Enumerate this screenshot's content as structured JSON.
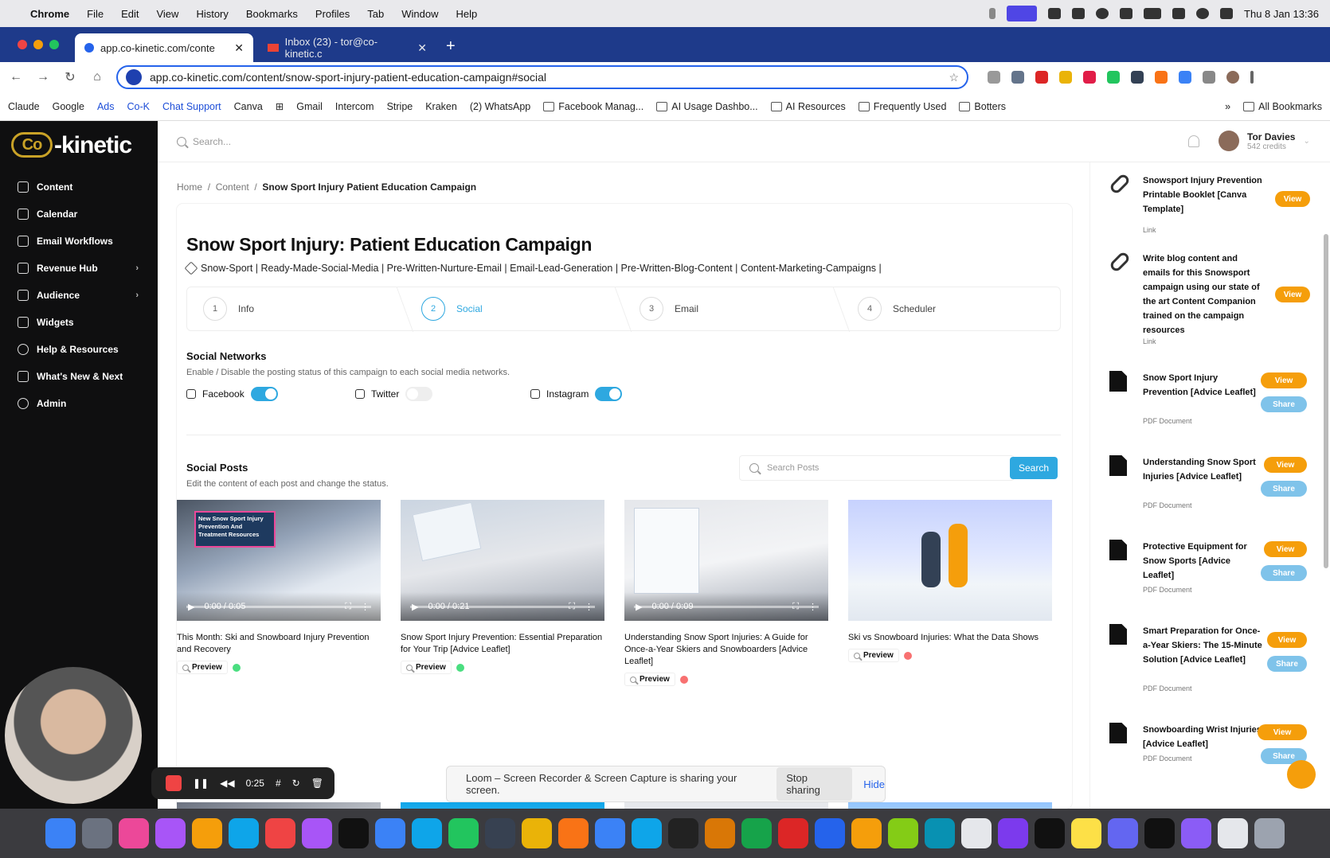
{
  "menubar": {
    "app": "Chrome",
    "items": [
      "File",
      "Edit",
      "View",
      "History",
      "Bookmarks",
      "Profiles",
      "Tab",
      "Window",
      "Help"
    ],
    "clock": "Thu 8 Jan  13:36"
  },
  "tabs": [
    {
      "title": "app.co-kinetic.com/conte",
      "close": "✕"
    },
    {
      "title": "Inbox (23) - tor@co-kinetic.c",
      "close": "✕"
    }
  ],
  "newtab": "+",
  "url": "app.co-kinetic.com/content/snow-sport-injury-patient-education-campaign#social",
  "bookmarks": [
    "Claude",
    "Google",
    "Ads",
    "Co-K",
    "Chat Support",
    "Canva",
    "Gmail",
    "Intercom",
    "Stripe",
    "Kraken",
    "(2) WhatsApp",
    "Facebook Manag...",
    "AI Usage Dashbo...",
    "AI Resources",
    "Frequently Used",
    "Botters"
  ],
  "bookmarks_more": "»",
  "all_bookmarks": "All Bookmarks",
  "logo": {
    "co": "Co",
    "text": "-kinetic"
  },
  "sidebar": [
    {
      "label": "Content",
      "chev": ""
    },
    {
      "label": "Calendar",
      "chev": ""
    },
    {
      "label": "Email Workflows",
      "chev": ""
    },
    {
      "label": "Revenue Hub",
      "chev": "›"
    },
    {
      "label": "Audience",
      "chev": "›"
    },
    {
      "label": "Widgets",
      "chev": ""
    },
    {
      "label": "Help & Resources",
      "chev": ""
    },
    {
      "label": "What's New & Next",
      "chev": ""
    },
    {
      "label": "Admin",
      "chev": ""
    }
  ],
  "topbar": {
    "search_placeholder": "Search...",
    "user_name": "Tor Davies",
    "user_credits": "542 credits"
  },
  "breadcrumb": {
    "home": "Home",
    "sep": "/",
    "content": "Content",
    "current": "Snow Sport Injury Patient Education Campaign"
  },
  "page": {
    "title": "Snow Sport Injury: Patient Education Campaign",
    "tags": "Snow-Sport | Ready-Made-Social-Media | Pre-Written-Nurture-Email | Email-Lead-Generation | Pre-Written-Blog-Content | Content-Marketing-Campaigns |"
  },
  "steps": [
    {
      "num": "1",
      "label": "Info"
    },
    {
      "num": "2",
      "label": "Social"
    },
    {
      "num": "3",
      "label": "Email"
    },
    {
      "num": "4",
      "label": "Scheduler"
    }
  ],
  "social_networks": {
    "title": "Social Networks",
    "subtitle": "Enable / Disable the posting status of this campaign to each social media networks.",
    "networks": [
      {
        "name": "Facebook",
        "enabled": true
      },
      {
        "name": "Twitter",
        "enabled": false
      },
      {
        "name": "Instagram",
        "enabled": true
      }
    ]
  },
  "social_posts": {
    "title": "Social Posts",
    "subtitle": "Edit the content of each post and change the status.",
    "search_placeholder": "Search Posts",
    "search_button": "Search",
    "preview_label": "Preview",
    "posts": [
      {
        "title": "This Month: Ski and Snowboard Injury Prevention and Recovery",
        "time": "0:00 / 0:05",
        "status_color": "#4ade80",
        "overlay": "New Snow Sport Injury Prevention And Treatment Resources"
      },
      {
        "title": "Snow Sport Injury Prevention: Essential Preparation for Your Trip [Advice Leaflet]",
        "time": "0:00 / 0:21",
        "status_color": "#4ade80",
        "overlay": ""
      },
      {
        "title": "Understanding Snow Sport Injuries: A Guide for Once-a-Year Skiers and Snowboarders [Advice Leaflet]",
        "time": "0:00 / 0:09",
        "status_color": "#f87171",
        "overlay": ""
      },
      {
        "title": "Ski vs Snowboard Injuries: What the Data Shows",
        "time": "",
        "status_color": "#f87171",
        "overlay": ""
      }
    ]
  },
  "resources": [
    {
      "title": "Snowsport Injury Prevention Printable Booklet [Canva Template]",
      "type": "Link",
      "icon": "link",
      "view": "View",
      "share": ""
    },
    {
      "title": "Write blog content and emails for this Snowsport campaign using our state of the art Content Companion trained on the campaign resources",
      "type": "Link",
      "icon": "link",
      "view": "View",
      "share": ""
    },
    {
      "title": "Snow Sport Injury Prevention [Advice Leaflet]",
      "type": "PDF Document",
      "icon": "doc",
      "view": "View",
      "share": "Share"
    },
    {
      "title": "Understanding Snow Sport Injuries [Advice Leaflet]",
      "type": "PDF Document",
      "icon": "doc",
      "view": "View",
      "share": "Share"
    },
    {
      "title": "Protective Equipment for Snow Sports [Advice Leaflet]",
      "type": "PDF Document",
      "icon": "doc",
      "view": "View",
      "share": "Share"
    },
    {
      "title": "Smart Preparation for Once-a-Year Skiers: The 15-Minute Solution [Advice Leaflet]",
      "type": "PDF Document",
      "icon": "doc",
      "view": "View",
      "share": "Share"
    },
    {
      "title": "Snowboarding Wrist Injuries [Advice Leaflet]",
      "type": "PDF Document",
      "icon": "doc",
      "view": "View",
      "share": "Share"
    }
  ],
  "loom": {
    "message": "Loom – Screen Recorder & Screen Capture is sharing your screen.",
    "stop": "Stop sharing",
    "hide": "Hide"
  },
  "recorder": {
    "time": "0:25"
  },
  "colors": {
    "accent": "#2ea8e0",
    "view_button": "#f59e0b",
    "tab_bar": "#1e3a8a"
  }
}
